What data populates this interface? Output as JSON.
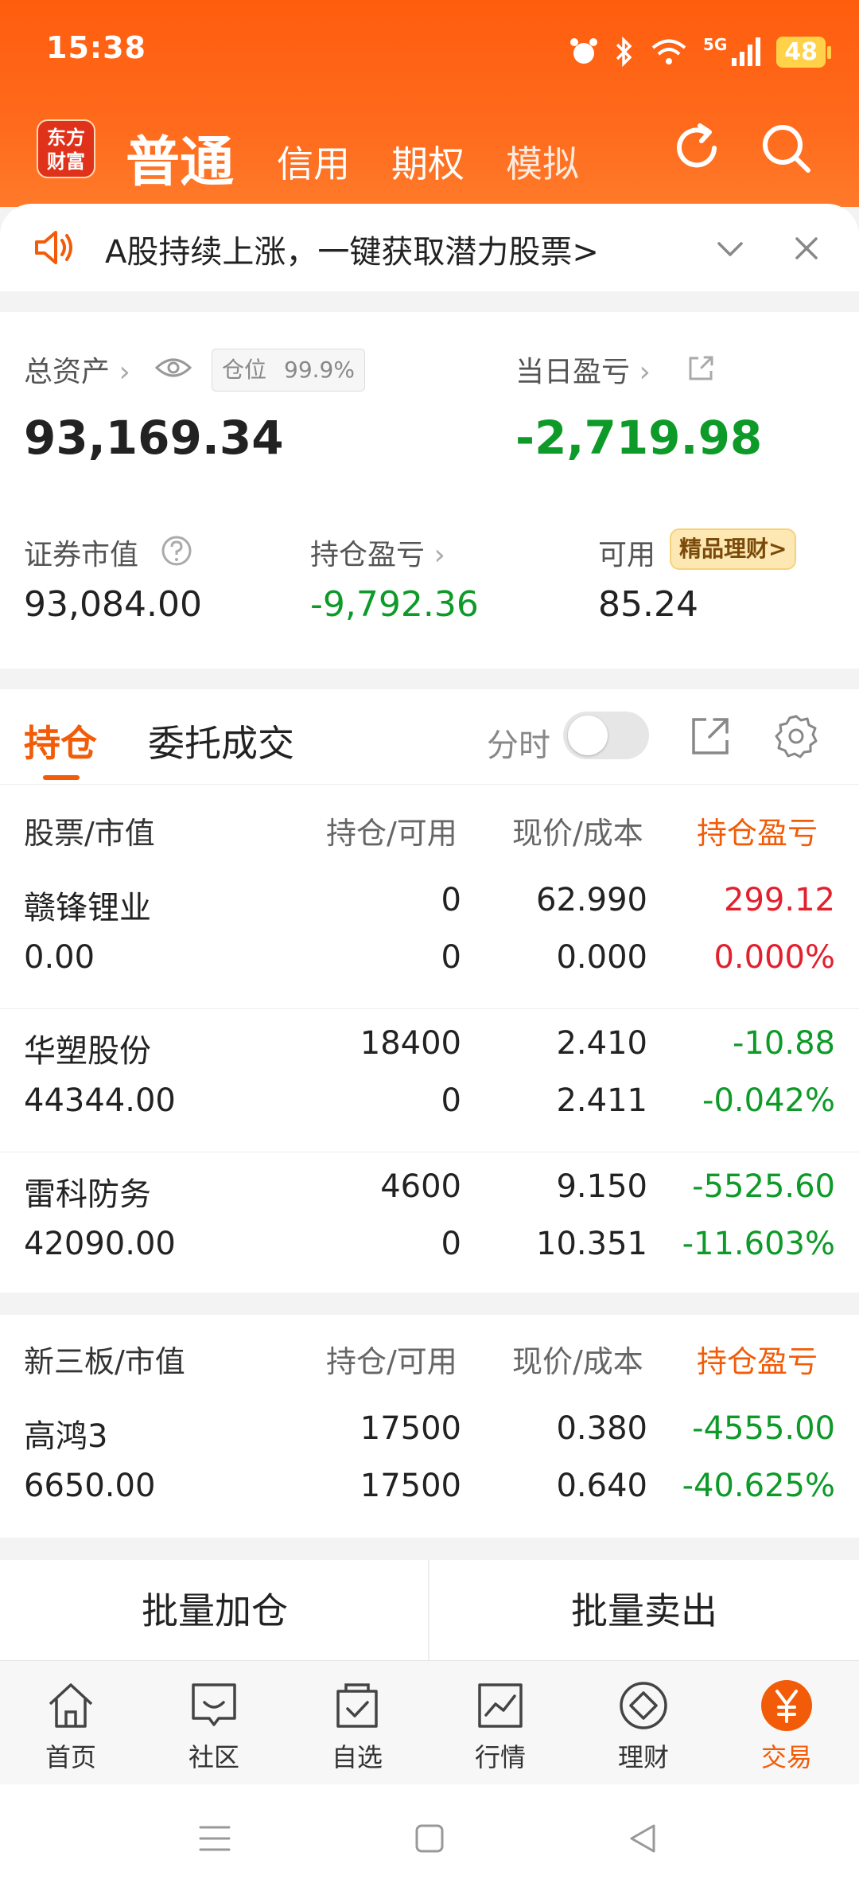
{
  "status_bar": {
    "time": "15:38",
    "network": "5G",
    "battery": "48"
  },
  "navbar": {
    "logo": "东方财富",
    "tabs": [
      "普通",
      "信用",
      "期权",
      "模拟"
    ],
    "icons": [
      "refresh-icon",
      "search-icon"
    ]
  },
  "notice": {
    "text": "A股持续上涨，一键获取潜力股票>"
  },
  "assets": {
    "total_label": "总资产",
    "total_value": "93,169.34",
    "position_label": "仓位",
    "position_value": "99.9%",
    "daily_label": "当日盈亏",
    "daily_value": "-2,719.98",
    "market_value_label": "证券市值",
    "market_value": "93,084.00",
    "hold_pl_label": "持仓盈亏",
    "hold_pl_value": "-9,792.36",
    "available_label": "可用",
    "available_value": "85.24",
    "finance_badge": "精品理财>"
  },
  "position_tabs": {
    "tabs": [
      "持仓",
      "委托成交"
    ],
    "time_share_label": "分时",
    "time_share_on": false
  },
  "stock_table": {
    "headers": [
      "股票/市值",
      "持仓/可用",
      "现价/成本",
      "持仓盈亏"
    ],
    "rows": [
      {
        "name": "赣锋锂业",
        "market_value": "0.00",
        "hold": "0",
        "available": "0",
        "price": "62.990",
        "cost": "0.000",
        "pl": "299.12",
        "pl_pct": "0.000%",
        "dir": "up"
      },
      {
        "name": "华塑股份",
        "market_value": "44344.00",
        "hold": "18400",
        "available": "0",
        "price": "2.410",
        "cost": "2.411",
        "pl": "-10.88",
        "pl_pct": "-0.042%",
        "dir": "down"
      },
      {
        "name": "雷科防务",
        "market_value": "42090.00",
        "hold": "4600",
        "available": "0",
        "price": "9.150",
        "cost": "10.351",
        "pl": "-5525.60",
        "pl_pct": "-11.603%",
        "dir": "down"
      }
    ]
  },
  "otc_table": {
    "headers": [
      "新三板/市值",
      "持仓/可用",
      "现价/成本",
      "持仓盈亏"
    ],
    "rows": [
      {
        "name": "高鸿3",
        "market_value": "6650.00",
        "hold": "17500",
        "available": "17500",
        "price": "0.380",
        "cost": "0.640",
        "pl": "-4555.00",
        "pl_pct": "-40.625%",
        "dir": "down"
      }
    ]
  },
  "batch": {
    "add_label": "批量加仓",
    "sell_label": "批量卖出"
  },
  "bottom_nav": [
    {
      "label": "首页",
      "icon": "home-icon"
    },
    {
      "label": "社区",
      "icon": "chat-icon"
    },
    {
      "label": "自选",
      "icon": "watchlist-icon"
    },
    {
      "label": "行情",
      "icon": "chart-icon"
    },
    {
      "label": "理财",
      "icon": "diamond-icon"
    },
    {
      "label": "交易",
      "icon": "yuan-icon",
      "active": true
    }
  ],
  "colors": {
    "brand": "#ff5d0e",
    "accent": "#f25c08",
    "up": "#e3202e",
    "down": "#0e9a29"
  }
}
